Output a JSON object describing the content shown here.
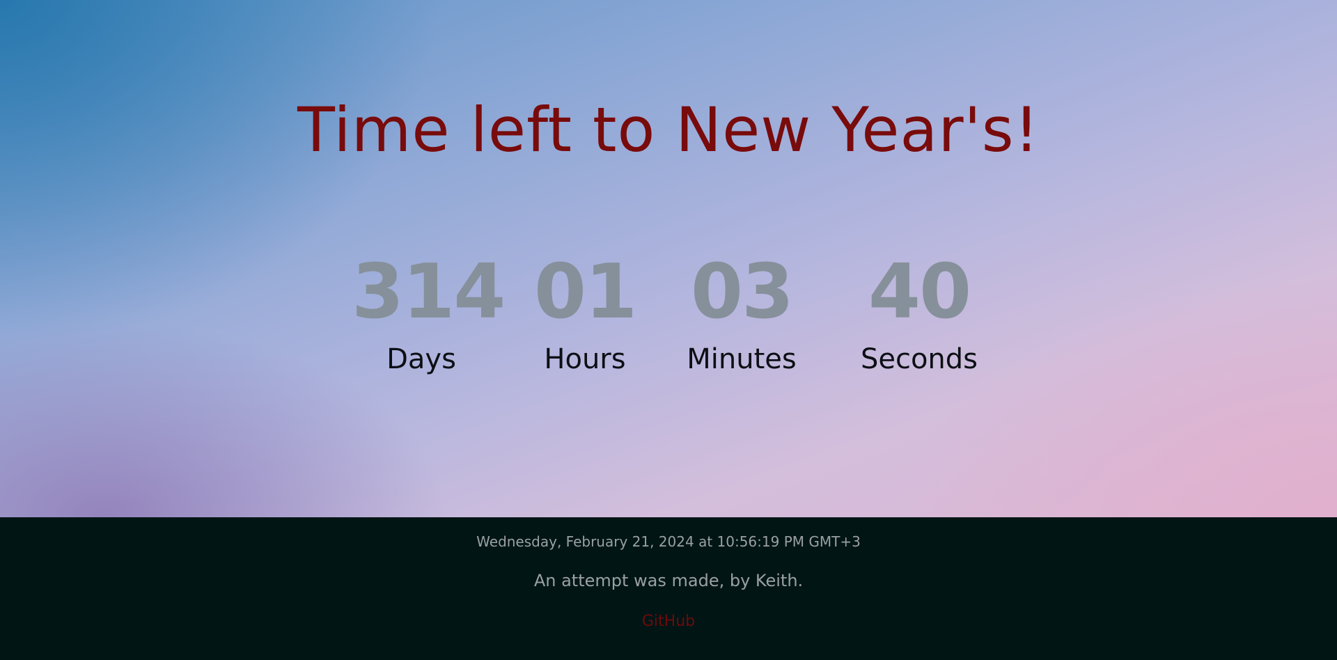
{
  "hero": {
    "title": "Time left to New Year's!"
  },
  "countdown": {
    "days": {
      "value": "314",
      "label": "Days"
    },
    "hours": {
      "value": "01",
      "label": "Hours"
    },
    "minutes": {
      "value": "03",
      "label": "Minutes"
    },
    "seconds": {
      "value": "40",
      "label": "Seconds"
    }
  },
  "footer": {
    "datetime": "Wednesday, February 21, 2024 at 10:56:19 PM GMT+3",
    "credit": "An attempt was made, by Keith.",
    "github_label": "GitHub"
  },
  "colors": {
    "title": "#780b0b",
    "number": "#86909a",
    "label": "#0c0f14",
    "footer_bg": "#011515",
    "footer_text": "#9aa0a4",
    "link": "#6f0a0a"
  }
}
